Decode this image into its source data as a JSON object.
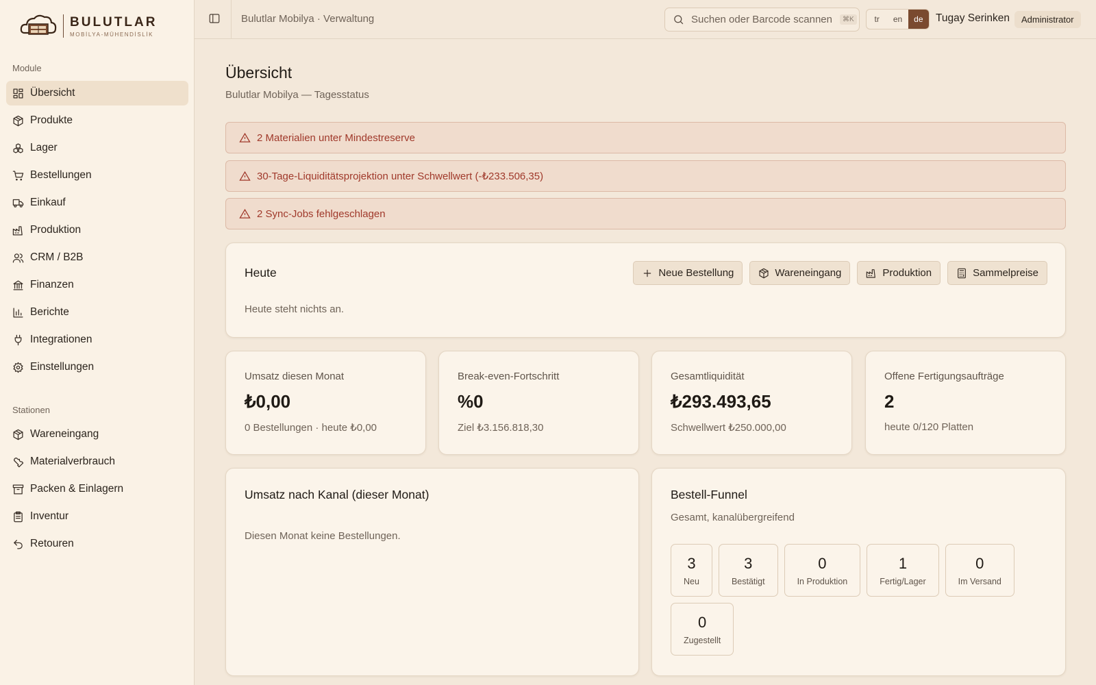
{
  "brand": {
    "name": "BULUTLAR",
    "tagline": "MOBİLYA-MÜHENDİSLİK"
  },
  "sidebar": {
    "modules_label": "Module",
    "modules": [
      {
        "label": "Übersicht",
        "icon": "dashboard-icon",
        "active": true
      },
      {
        "label": "Produkte",
        "icon": "package-icon"
      },
      {
        "label": "Lager",
        "icon": "boxes-icon"
      },
      {
        "label": "Bestellungen",
        "icon": "cart-icon"
      },
      {
        "label": "Einkauf",
        "icon": "truck-icon"
      },
      {
        "label": "Produktion",
        "icon": "factory-icon"
      },
      {
        "label": "CRM / B2B",
        "icon": "users-icon"
      },
      {
        "label": "Finanzen",
        "icon": "bank-icon"
      },
      {
        "label": "Berichte",
        "icon": "bar-chart-icon"
      },
      {
        "label": "Integrationen",
        "icon": "plug-icon"
      },
      {
        "label": "Einstellungen",
        "icon": "gear-icon"
      }
    ],
    "stations_label": "Stationen",
    "stations": [
      {
        "label": "Wareneingang",
        "icon": "package-icon"
      },
      {
        "label": "Materialverbrauch",
        "icon": "wrench-icon"
      },
      {
        "label": "Packen & Einlagern",
        "icon": "archive-icon"
      },
      {
        "label": "Inventur",
        "icon": "clipboard-icon"
      },
      {
        "label": "Retouren",
        "icon": "undo-icon"
      }
    ]
  },
  "topbar": {
    "breadcrumb": "Bulutlar Mobilya · Verwaltung",
    "search_placeholder": "Suchen oder Barcode scannen",
    "search_shortcut": "⌘K",
    "languages": [
      "tr",
      "en",
      "de"
    ],
    "active_language": "de",
    "user_name": "Tugay Serinken",
    "user_role": "Administrator"
  },
  "page": {
    "title": "Übersicht",
    "subtitle": "Bulutlar Mobilya — Tagesstatus"
  },
  "alerts": [
    "2 Materialien unter Mindestreserve",
    "30-Tage-Liquiditätsprojektion unter Schwellwert (-₺233.506,35)",
    "2 Sync-Jobs fehlgeschlagen"
  ],
  "today": {
    "title": "Heute",
    "empty_text": "Heute steht nichts an.",
    "actions": [
      "Neue Bestellung",
      "Wareneingang",
      "Produktion",
      "Sammelpreise"
    ]
  },
  "kpis": [
    {
      "label": "Umsatz diesen Monat",
      "value": "₺0,00",
      "sub": "0 Bestellungen · heute ₺0,00"
    },
    {
      "label": "Break-even-Fortschritt",
      "value": "%0",
      "sub": "Ziel ₺3.156.818,30"
    },
    {
      "label": "Gesamtliquidität",
      "value": "₺293.493,65",
      "sub": "Schwellwert ₺250.000,00"
    },
    {
      "label": "Offene Fertigungsaufträge",
      "value": "2",
      "sub": "heute 0/120 Platten"
    }
  ],
  "channel_panel": {
    "title": "Umsatz nach Kanal (dieser Monat)",
    "empty_text": "Diesen Monat keine Bestellungen."
  },
  "funnel_panel": {
    "title": "Bestell-Funnel",
    "subtitle": "Gesamt, kanalübergreifend",
    "stages": [
      {
        "count": "3",
        "label": "Neu"
      },
      {
        "count": "3",
        "label": "Bestätigt"
      },
      {
        "count": "0",
        "label": "In Produktion"
      },
      {
        "count": "1",
        "label": "Fertig/Lager"
      },
      {
        "count": "0",
        "label": "Im Versand"
      },
      {
        "count": "0",
        "label": "Zugestellt"
      }
    ]
  },
  "colors": {
    "accent": "#7a4a2f",
    "alert_text": "#a0392b",
    "alert_bg": "#f0dccd",
    "background": "#f3e8da"
  }
}
